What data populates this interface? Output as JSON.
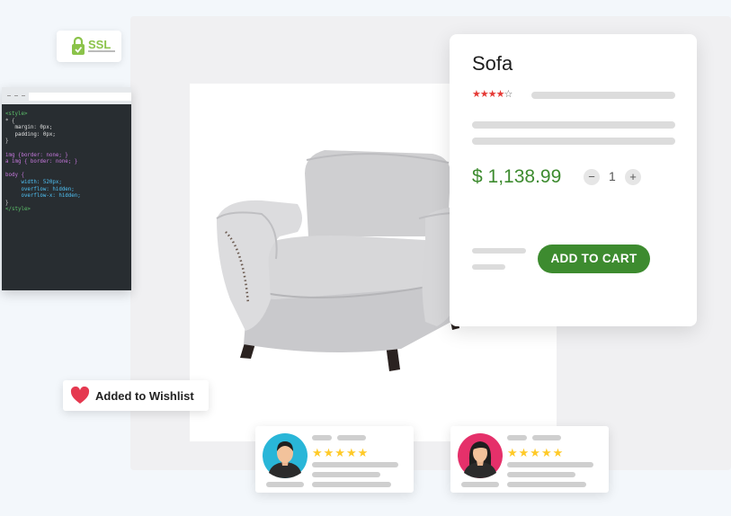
{
  "ssl_badge": {
    "label": "SSL"
  },
  "code_editor": {
    "lines": [
      "<style>",
      "* {",
      "   margin: 0px;",
      "   padding: 0px;",
      "}",
      "",
      "img {border: none; }",
      "a img { border: none; }",
      "",
      "body {",
      "     width: 520px;",
      "     overflow: hidden;",
      "     overflow-x: hidden;",
      "}",
      "</style>"
    ]
  },
  "product": {
    "name": "Sofa",
    "rating": 4,
    "rating_max": 5,
    "price": "$ 1,138.99",
    "quantity": "1",
    "decrement_symbol": "−",
    "increment_symbol": "+",
    "add_to_cart_label": "ADD TO CART"
  },
  "wishlist_toast": {
    "label": "Added to Wishlist",
    "heart_color": "#e53950"
  },
  "reviews": [
    {
      "avatar": "male-user-icon",
      "avatar_color": "#29b6d8",
      "rating": 5
    },
    {
      "avatar": "female-user-icon",
      "avatar_color": "#e5306a",
      "rating": 5
    }
  ],
  "colors": {
    "accent": "#3d8b2f",
    "star_rating": "#e53935",
    "review_star": "#ffca28"
  }
}
